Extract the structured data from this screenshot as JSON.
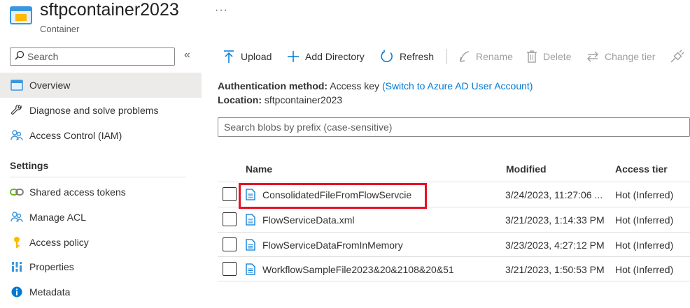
{
  "header": {
    "title": "sftpcontainer2023",
    "subtitle": "Container",
    "more": "···",
    "icon": "container-icon"
  },
  "sidebar": {
    "search_label": "Search",
    "collapse": "«",
    "items": [
      {
        "label": "Overview",
        "icon": "overview-icon",
        "active": true
      },
      {
        "label": "Diagnose and solve problems",
        "icon": "wrench-icon"
      },
      {
        "label": "Access Control (IAM)",
        "icon": "people-icon"
      }
    ],
    "settings_heading": "Settings",
    "settings_items": [
      {
        "label": "Shared access tokens",
        "icon": "link-icon"
      },
      {
        "label": "Manage ACL",
        "icon": "people-icon"
      },
      {
        "label": "Access policy",
        "icon": "key-icon"
      },
      {
        "label": "Properties",
        "icon": "properties-icon"
      },
      {
        "label": "Metadata",
        "icon": "info-icon"
      }
    ]
  },
  "toolbar": {
    "upload": "Upload",
    "add_directory": "Add Directory",
    "refresh": "Refresh",
    "rename": "Rename",
    "delete": "Delete",
    "change_tier": "Change tier"
  },
  "info": {
    "auth_label": "Authentication method:",
    "auth_value": "Access key",
    "auth_link": "(Switch to Azure AD User Account)",
    "location_label": "Location:",
    "location_value": "sftpcontainer2023"
  },
  "blob_search": {
    "placeholder": "Search blobs by prefix (case-sensitive)"
  },
  "table": {
    "columns": [
      "Name",
      "Modified",
      "Access tier"
    ],
    "rows": [
      {
        "name": "ConsolidatedFileFromFlowServcie",
        "modified": "3/24/2023, 11:27:06 ...",
        "tier": "Hot (Inferred)"
      },
      {
        "name": "FlowServiceData.xml",
        "modified": "3/21/2023, 1:14:33 PM",
        "tier": "Hot (Inferred)"
      },
      {
        "name": "FlowServiceDataFromInMemory",
        "modified": "3/23/2023, 4:27:12 PM",
        "tier": "Hot (Inferred)"
      },
      {
        "name": "WorkflowSampleFile2023&20&2108&20&51",
        "modified": "3/21/2023, 1:50:53 PM",
        "tier": "Hot (Inferred)"
      }
    ]
  },
  "colors": {
    "accent": "#0078d4",
    "highlight": "#e81123"
  }
}
